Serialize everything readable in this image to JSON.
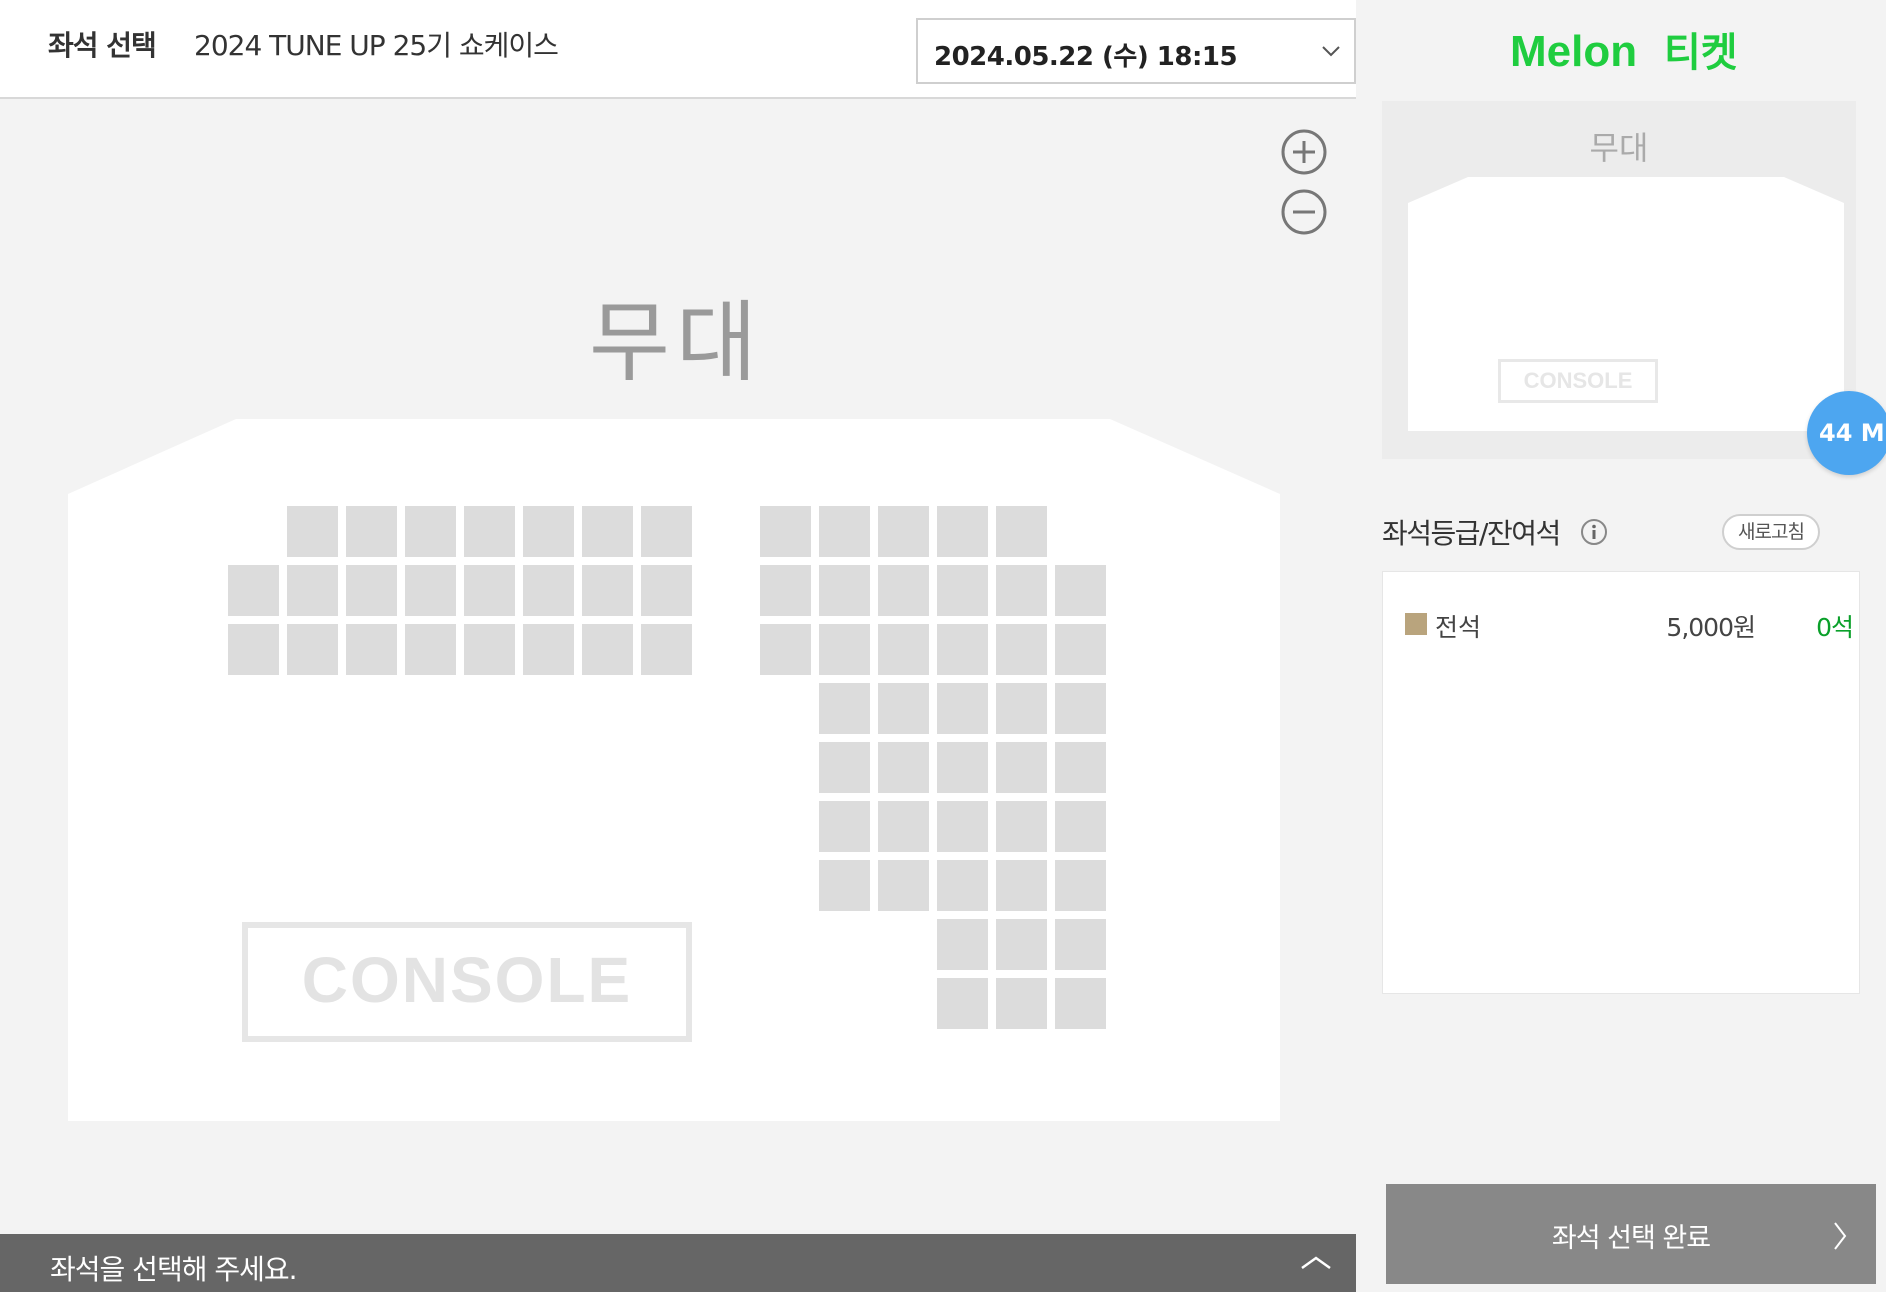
{
  "header": {
    "title": "좌석 선택",
    "show_name": "2024 TUNE UP 25기 쇼케이스",
    "date_select": {
      "value": "2024.05.22 (수) 18:15"
    }
  },
  "seat_map": {
    "stage_label": "무대",
    "console_label": "CONSOLE",
    "zoom_in_icon": "zoom-in-icon",
    "zoom_out_icon": "zoom-out-icon",
    "seat_color": "#dcdcdc"
  },
  "bottom_bar": {
    "message": "좌석을 선택해 주세요.",
    "icon": "chevron-up-icon"
  },
  "brand": {
    "name": "Melon",
    "suffix": "티켓",
    "color": "#1fcd3f"
  },
  "minimap": {
    "stage_label": "무대",
    "console_label": "CONSOLE"
  },
  "size_badge": {
    "label": "44 M",
    "color": "#4da6f0"
  },
  "grade_section": {
    "heading": "좌석등급/잔여석",
    "info_icon": "info-icon",
    "refresh_label": "새로고침",
    "grades": [
      {
        "name": "전석",
        "price": "5,000원",
        "remaining": "0석",
        "color": "#b9a47d"
      }
    ]
  },
  "complete_button": {
    "label": "좌석 선택 완료",
    "icon": "chevron-right-icon"
  }
}
